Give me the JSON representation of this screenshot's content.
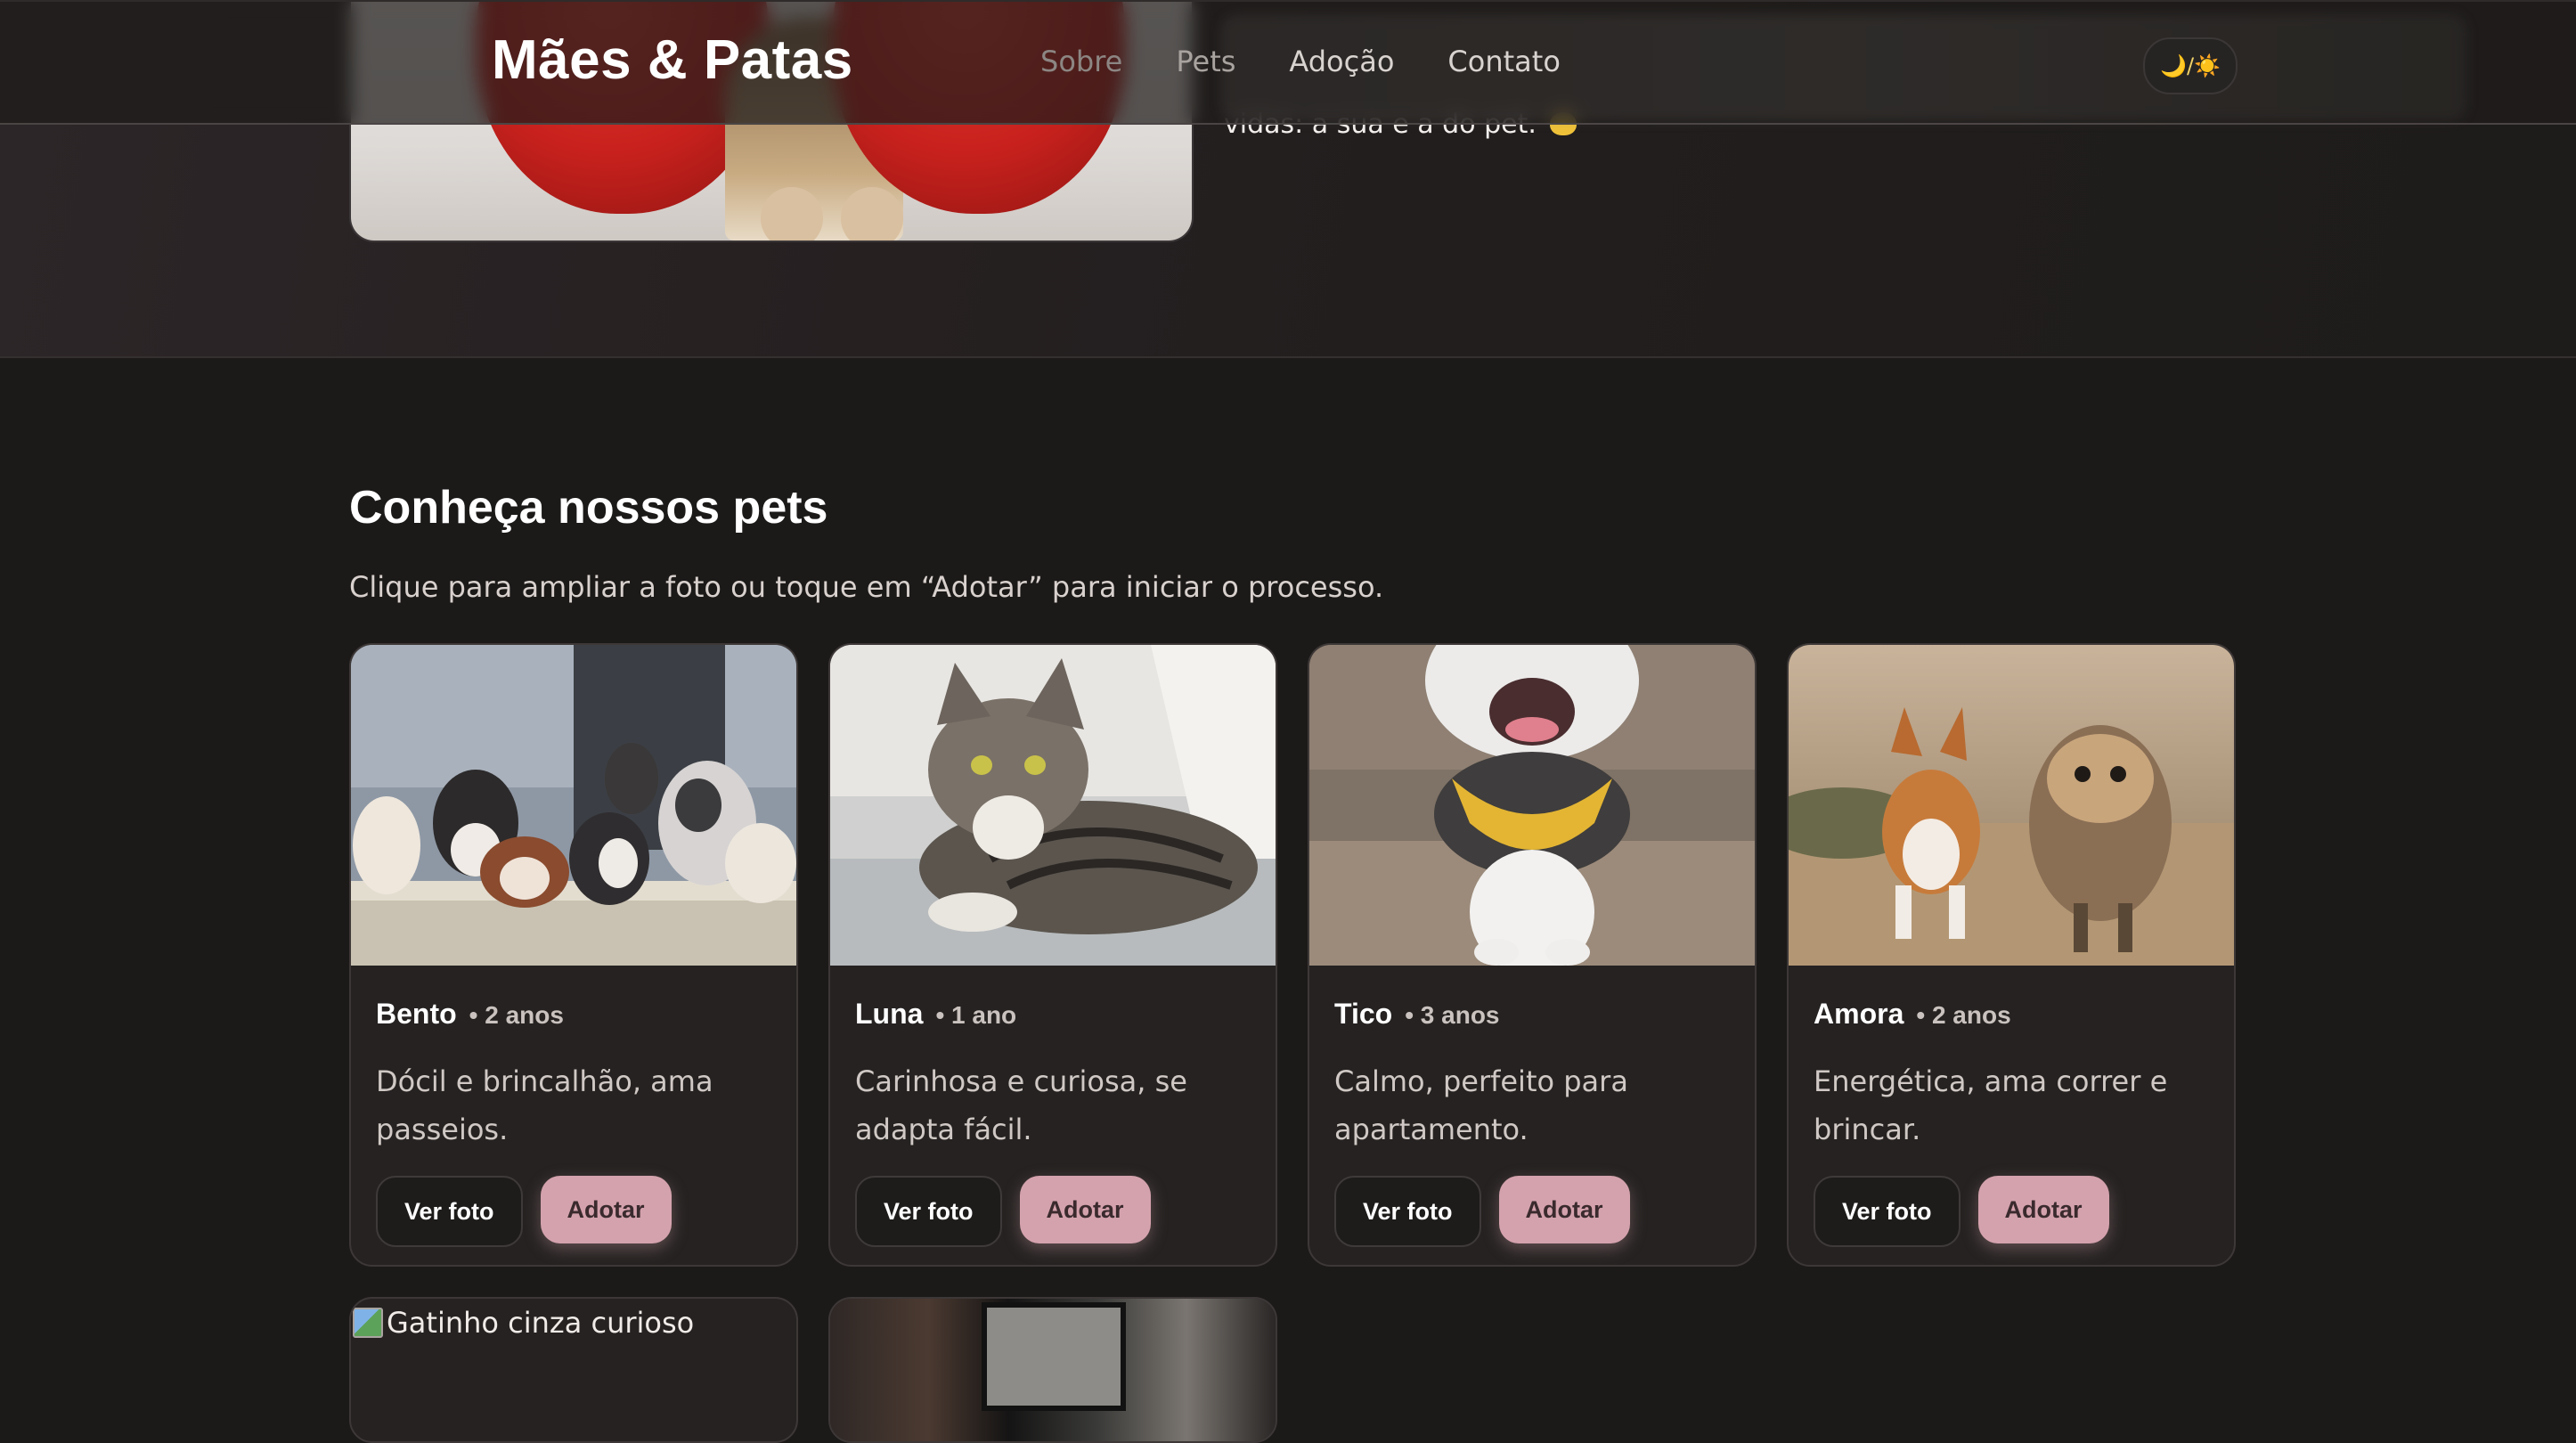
{
  "header": {
    "brand": "Mães & Patas",
    "nav": [
      {
        "label": "Sobre"
      },
      {
        "label": "Pets"
      },
      {
        "label": "Adoção"
      },
      {
        "label": "Contato"
      }
    ],
    "theme_toggle": "🌙/☀️"
  },
  "hero": {
    "text_tail": "vidas: a sua e a do pet."
  },
  "pets_section": {
    "title": "Conheça nossos pets",
    "subtitle": "Clique para ampliar a foto ou toque em “Adotar” para iniciar o processo.",
    "cards": [
      {
        "name": "Bento",
        "age": "• 2 anos",
        "desc": "Dócil e brincalhão, ama passeios.",
        "btn_view": "Ver foto",
        "btn_adopt": "Adotar"
      },
      {
        "name": "Luna",
        "age": "• 1 ano",
        "desc": "Carinhosa e curiosa, se adapta fácil.",
        "btn_view": "Ver foto",
        "btn_adopt": "Adotar"
      },
      {
        "name": "Tico",
        "age": "• 3 anos",
        "desc": "Calmo, perfeito para apartamento.",
        "btn_view": "Ver foto",
        "btn_adopt": "Adotar"
      },
      {
        "name": "Amora",
        "age": "• 2 anos",
        "desc": "Energética, ama correr e brincar.",
        "btn_view": "Ver foto",
        "btn_adopt": "Adotar"
      }
    ],
    "partial_cards": [
      {
        "broken_alt": "Gatinho cinza curioso"
      },
      {}
    ]
  },
  "colors": {
    "background": "#1c1a19",
    "card": "#252221",
    "accent_pink": "#d4a2ad",
    "text": "#ffffff"
  }
}
